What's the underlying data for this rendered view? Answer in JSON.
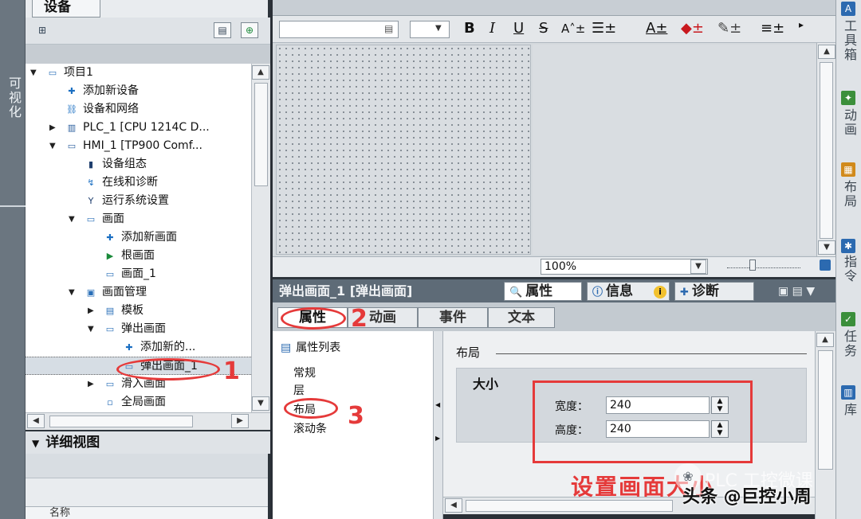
{
  "left_strip": {
    "label": "可视化"
  },
  "tree": {
    "tab": "设备",
    "items": [
      {
        "label": "项目1",
        "level": 0,
        "expand": "open",
        "icon": "project-icon"
      },
      {
        "label": "添加新设备",
        "level": 1,
        "expand": "none",
        "icon": "add-device-icon"
      },
      {
        "label": "设备和网络",
        "level": 1,
        "expand": "none",
        "icon": "network-icon"
      },
      {
        "label": "PLC_1 [CPU 1214C D...",
        "level": 1,
        "expand": "closed",
        "icon": "plc-icon"
      },
      {
        "label": "HMI_1 [TP900 Comf...",
        "level": 1,
        "expand": "open",
        "icon": "hmi-icon"
      },
      {
        "label": "设备组态",
        "level": 2,
        "expand": "none",
        "icon": "device-config-icon"
      },
      {
        "label": "在线和诊断",
        "level": 2,
        "expand": "none",
        "icon": "online-diagnostics-icon"
      },
      {
        "label": "运行系统设置",
        "level": 2,
        "expand": "none",
        "icon": "runtime-settings-icon"
      },
      {
        "label": "画面",
        "level": 2,
        "expand": "open",
        "icon": "folder-icon"
      },
      {
        "label": "添加新画面",
        "level": 3,
        "expand": "none",
        "icon": "add-screen-icon"
      },
      {
        "label": "根画面",
        "level": 3,
        "expand": "none",
        "icon": "root-screen-icon"
      },
      {
        "label": "画面_1",
        "level": 3,
        "expand": "none",
        "icon": "screen-icon"
      },
      {
        "label": "画面管理",
        "level": 2,
        "expand": "open",
        "icon": "screen-management-icon"
      },
      {
        "label": "模板",
        "level": 3,
        "expand": "closed",
        "icon": "template-icon"
      },
      {
        "label": "弹出画面",
        "level": 3,
        "expand": "open",
        "icon": "folder-icon"
      },
      {
        "label": "添加新的...",
        "level": 4,
        "expand": "none",
        "icon": "add-screen-icon"
      },
      {
        "label": "弹出画面_1",
        "level": 4,
        "expand": "none",
        "icon": "screen-icon"
      },
      {
        "label": "滑入画面",
        "level": 3,
        "expand": "closed",
        "icon": "folder-icon"
      },
      {
        "label": "全局画面",
        "level": 3,
        "expand": "none",
        "icon": "global-screen-icon"
      }
    ]
  },
  "details": {
    "title": "详细视图",
    "column": "名称"
  },
  "editor": {
    "toolbar_glyphs": [
      "B",
      "I",
      "U",
      "S"
    ],
    "zoom": "100%"
  },
  "inspector": {
    "title": "弹出画面_1 [弹出画面]",
    "tabs": [
      "属性",
      "信息",
      "诊断"
    ],
    "subtabs": [
      "属性",
      "动画",
      "事件",
      "文本"
    ],
    "list_title": "属性列表",
    "list_items": [
      "常规",
      "层",
      "布局",
      "滚动条"
    ],
    "section": "布局",
    "group": "大小",
    "width_label": "宽度：",
    "height_label": "高度：",
    "width_value": "240",
    "height_value": "240"
  },
  "right_dock": {
    "items": [
      "工具箱",
      "动画",
      "布局",
      "指令",
      "任务",
      "库"
    ]
  },
  "annotations": {
    "num1": "1",
    "num2": "2",
    "num3": "3",
    "caption": "设置画面大小",
    "color": "#e53a3a"
  },
  "watermark": {
    "ghost": "PLC 工控微课",
    "text": "头条 @巨控小周"
  }
}
